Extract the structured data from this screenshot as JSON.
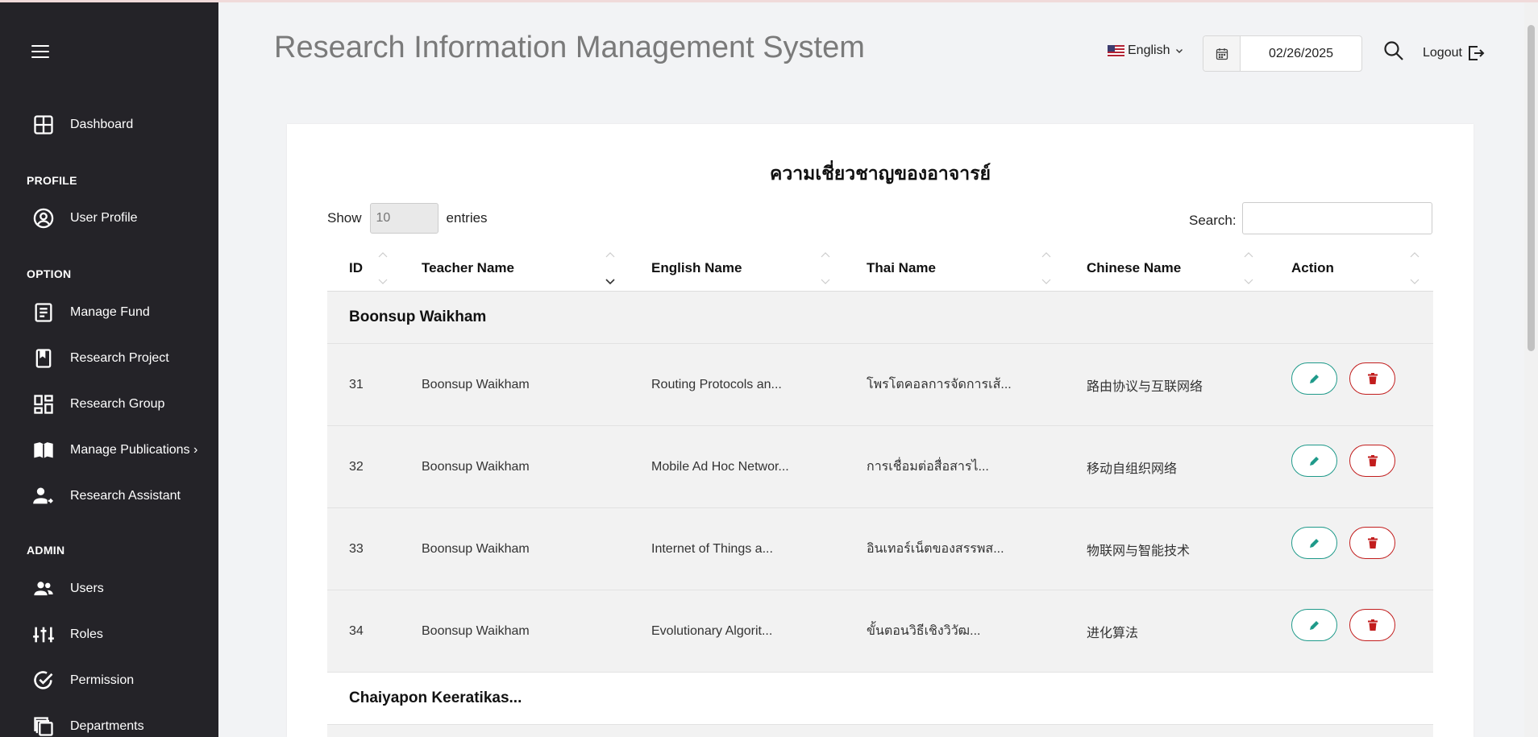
{
  "header": {
    "title": "Research Information Management System",
    "language": "English",
    "date": "02/26/2025",
    "logout_label": "Logout"
  },
  "sidebar": {
    "dashboard": "Dashboard",
    "profile_heading": "PROFILE",
    "user_profile": "User Profile",
    "option_heading": "OPTION",
    "manage_fund": "Manage Fund",
    "research_project": "Research Project",
    "research_group": "Research Group",
    "manage_publications": "Manage Publications ›",
    "research_assistant": "Research Assistant",
    "admin_heading": "ADMIN",
    "users": "Users",
    "roles": "Roles",
    "permission": "Permission",
    "departments": "Departments"
  },
  "card": {
    "title": "ความเชี่ยวชาญของอาจารย์",
    "show_label": "Show",
    "entries_value": "10",
    "entries_label": "entries",
    "search_label": "Search:"
  },
  "table": {
    "columns": [
      "ID",
      "Teacher Name",
      "English Name",
      "Thai Name",
      "Chinese Name",
      "Action"
    ],
    "groups": [
      "Boonsup Waikham",
      "Chaiyapon Keeratikas..."
    ],
    "rows": [
      {
        "id": "31",
        "teacher": "Boonsup Waikham",
        "english": "Routing Protocols an...",
        "thai": "โพรโตคอลการจัดการเส้...",
        "chinese": "路由协议与互联网络"
      },
      {
        "id": "32",
        "teacher": "Boonsup Waikham",
        "english": "Mobile Ad Hoc Networ...",
        "thai": "การเชื่อมต่อสื่อสารไ...",
        "chinese": "移动自组织网络"
      },
      {
        "id": "33",
        "teacher": "Boonsup Waikham",
        "english": "Internet of Things a...",
        "thai": "อินเทอร์เน็ตของสรรพส...",
        "chinese": "物联网与智能技术"
      },
      {
        "id": "34",
        "teacher": "Boonsup Waikham",
        "english": "Evolutionary Algorit...",
        "thai": "ขั้นตอนวิธีเชิงวิวัฒ...",
        "chinese": "进化算法"
      }
    ]
  },
  "colors": {
    "sidebar_bg": "#242328",
    "edit_accent": "#1f9a8a",
    "delete_accent": "#c21d1d"
  }
}
